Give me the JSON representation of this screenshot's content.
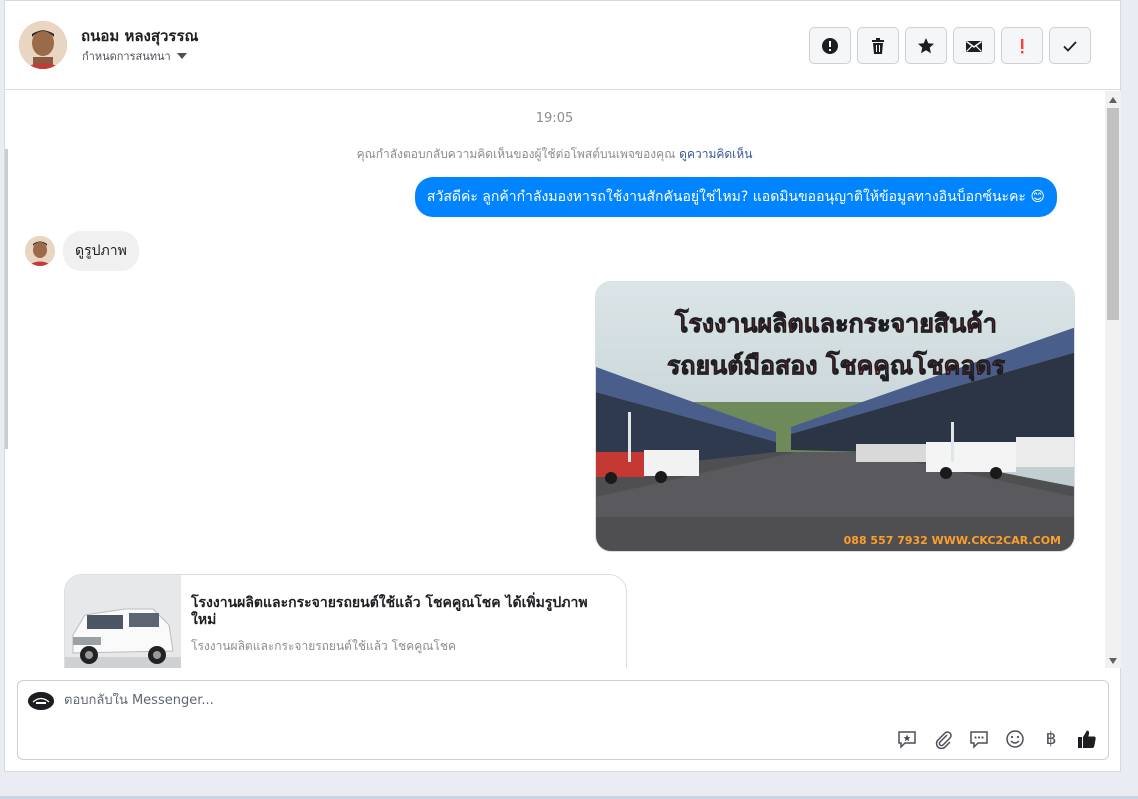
{
  "header": {
    "name": "ถนอม หลงสุวรรณ",
    "subtitle": "กำหนดการสนทนา",
    "actions": [
      {
        "name": "alert-circle-icon",
        "color": "#1c1e21"
      },
      {
        "name": "trash-icon",
        "color": "#1c1e21"
      },
      {
        "name": "star-icon",
        "color": "#1c1e21"
      },
      {
        "name": "mail-icon",
        "color": "#1c1e21"
      },
      {
        "name": "exclamation-icon",
        "color": "#fa3e3e"
      },
      {
        "name": "check-icon",
        "color": "#1c1e21"
      }
    ]
  },
  "thread": {
    "time": "19:05",
    "notice_text": "คุณกำลังตอบกลับความคิดเห็นของผู้ใช้ต่อโพสต์บนเพจของคุณ",
    "notice_link": "ดูความคิดเห็น",
    "outgoing_message": "สวัสดีค่ะ ลูกค้ากำลังมองหารถใช้งานสักคันอยู่ใช่ไหม? แอดมินขออนุญาติให้ข้อมูลทางอินบ็อกซ์นะคะ 😊",
    "incoming_message": "ดูรูปภาพ",
    "image": {
      "line1": "โรงงานผลิตและกระจายสินค้า",
      "line2": "รถยนต์มือสอง โชคคูณโชคอุดร",
      "footer": "088 557 7932 WWW.CKC2CAR.COM"
    },
    "link_card": {
      "title": "โรงงานผลิตและกระจายรถยนต์ใช้แล้ว โชคคูณโชค ได้เพิ่มรูปภาพใหม่",
      "subtitle": "โรงงานผลิตและกระจายรถยนต์ใช้แล้ว โชคคูณโชค"
    }
  },
  "composer": {
    "placeholder": "ตอบกลับใน Messenger...",
    "value": "",
    "tools": [
      "saved-reply-icon",
      "attachment-icon",
      "chat-icon",
      "emoji-icon",
      "baht-icon",
      "like-icon"
    ],
    "baht_symbol": "฿"
  },
  "colors": {
    "accent": "#0084ff",
    "link": "#385898",
    "title_text": "#ff2a2a"
  }
}
